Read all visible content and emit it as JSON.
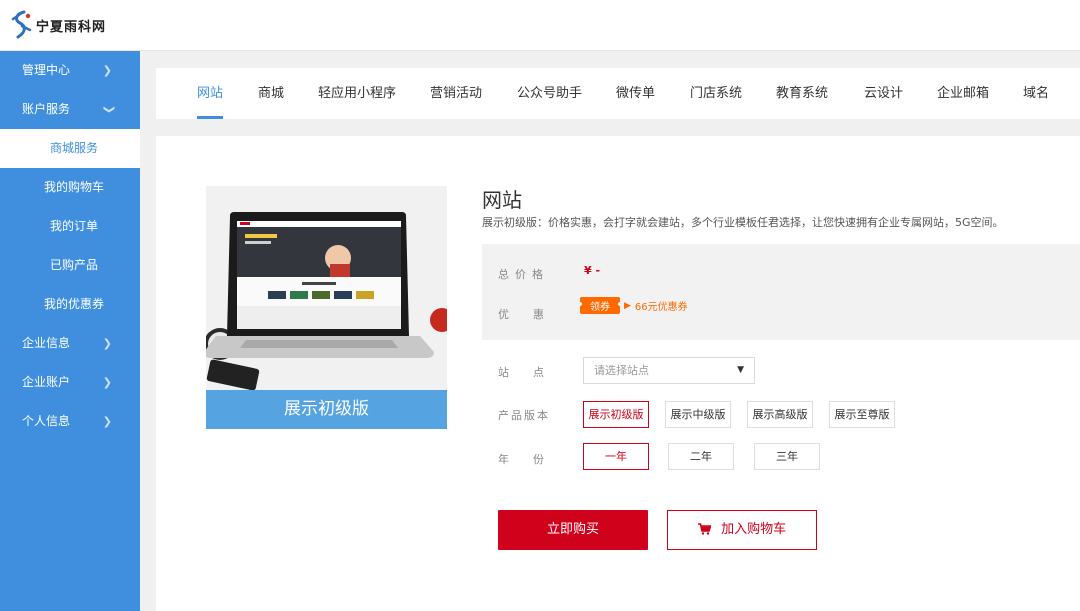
{
  "brand": {
    "name": "宁夏雨科网"
  },
  "sidebar": {
    "items": [
      {
        "label": "管理中心",
        "type": "top",
        "chevron": "right"
      },
      {
        "label": "账户服务",
        "type": "top",
        "chevron": "down"
      },
      {
        "label": "商城服务",
        "type": "sub",
        "active": true
      },
      {
        "label": "我的购物车",
        "type": "sub"
      },
      {
        "label": "我的订单",
        "type": "sub"
      },
      {
        "label": "已购产品",
        "type": "sub"
      },
      {
        "label": "我的优惠券",
        "type": "sub"
      },
      {
        "label": "企业信息",
        "type": "top",
        "chevron": "right"
      },
      {
        "label": "企业账户",
        "type": "top",
        "chevron": "right"
      },
      {
        "label": "个人信息",
        "type": "top",
        "chevron": "right"
      }
    ]
  },
  "tabs": [
    {
      "label": "网站",
      "active": true
    },
    {
      "label": "商城"
    },
    {
      "label": "轻应用小程序"
    },
    {
      "label": "营销活动"
    },
    {
      "label": "公众号助手"
    },
    {
      "label": "微传单"
    },
    {
      "label": "门店系统"
    },
    {
      "label": "教育系统"
    },
    {
      "label": "云设计"
    },
    {
      "label": "企业邮箱"
    },
    {
      "label": "域名"
    }
  ],
  "product": {
    "image_banner": "展示初级版",
    "title": "网站",
    "description": "展示初级版：价格实惠，会打字就会建站，多个行业模板任君选择，让您快速拥有企业专属网站，5G空间。",
    "price_label": "总价格",
    "price_value": "¥ -",
    "discount_label": "优惠",
    "coupon_tag": "领券",
    "coupon_text": "66元优惠券",
    "site_label": "站点",
    "site_placeholder": "请选择站点",
    "version_label": "产品版本",
    "versions": [
      "展示初级版",
      "展示中级版",
      "展示高级版",
      "展示至尊版"
    ],
    "selected_version": 0,
    "year_label": "年份",
    "years": [
      "一年",
      "二年",
      "三年"
    ],
    "selected_year": 0,
    "buy_label": "立即购买",
    "cart_label": "加入购物车"
  },
  "colors": {
    "sidebar": "#3f8fde",
    "accent": "#3f8fde",
    "buy": "#d0021b",
    "coupon": "#ff6a00"
  }
}
